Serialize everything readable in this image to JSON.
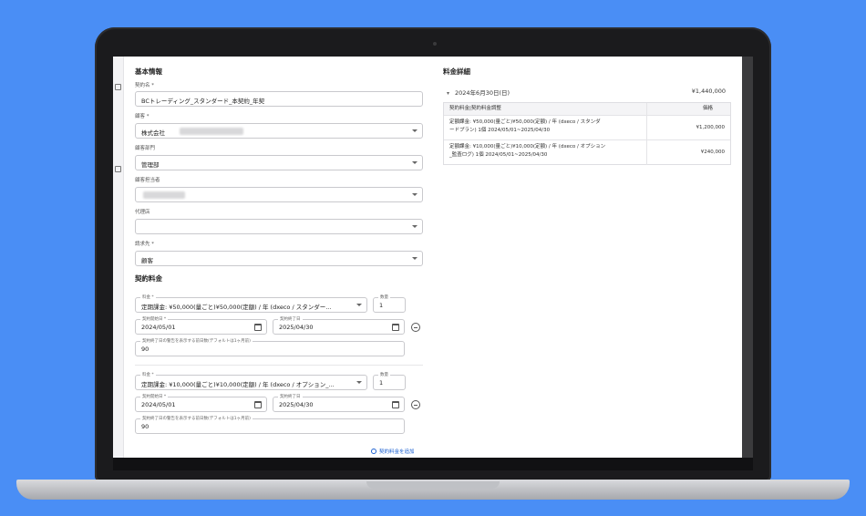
{
  "basic_info": {
    "title": "基本情報",
    "contract_name": {
      "label": "契約名 *",
      "value": "BCトレーディング_スタンダード_本契約_年契"
    },
    "customer": {
      "label": "顧客 *",
      "value": "株式会社"
    },
    "customer_department": {
      "label": "顧客部門",
      "value": "管理部"
    },
    "customer_contact": {
      "label": "顧客担当者",
      "value": ""
    },
    "agency": {
      "label": "代理店",
      "value": ""
    },
    "billing": {
      "label": "請求先 *",
      "value": "顧客"
    }
  },
  "contract_fees": {
    "title": "契約料金",
    "items": [
      {
        "fee_label": "料金 *",
        "fee_value": "定期課金: ¥50,000(量ごと)¥50,000(定額) / 年 (dxeco / スタンダー...",
        "qty_label": "数量",
        "qty_value": "1",
        "start_label": "契約開始日 *",
        "start_value": "2024/05/01",
        "end_label": "契約終了日",
        "end_value": "2025/04/30",
        "notice_label": "契約終了日の警告を表示する前日数(デフォルトは1ヶ月前)",
        "notice_value": "90"
      },
      {
        "fee_label": "料金 *",
        "fee_value": "定期課金: ¥10,000(量ごと)¥10,000(定額) / 年 (dxeco / オプション_...",
        "qty_label": "数量",
        "qty_value": "1",
        "start_label": "契約開始日 *",
        "start_value": "2024/05/01",
        "end_label": "契約終了日",
        "end_value": "2025/04/30",
        "notice_label": "契約終了日の警告を表示する前日数(デフォルトは1ヶ月前)",
        "notice_value": "90"
      }
    ],
    "add_label": "契約料金を追加"
  },
  "fee_details": {
    "title": "料金詳細",
    "period": "2024年6月30日(日)",
    "period_total": "¥1,440,000",
    "headers": [
      "契約料金|契約料金調整",
      "価格"
    ],
    "rows": [
      {
        "desc_line1": "定額課金: ¥50,000(量ごと)¥50,000(定額) / 年 (dxeco / スタンダ",
        "desc_line2": "ードプラン) 1個 2024/05/01~2025/04/30",
        "price": "¥1,200,000"
      },
      {
        "desc_line1": "定額課金: ¥10,000(量ごと)¥10,000(定額) / 年 (dxeco / オプション",
        "desc_line2": "_監査ログ) 1個 2024/05/01~2025/04/30",
        "price": "¥240,000"
      }
    ]
  },
  "icons": [
    "chevron-down-icon",
    "calendar-icon",
    "remove-circle-icon",
    "add-circle-icon",
    "expand-more-icon"
  ],
  "colors": {
    "background": "#4a8ef5",
    "link": "#1a5fd0"
  }
}
